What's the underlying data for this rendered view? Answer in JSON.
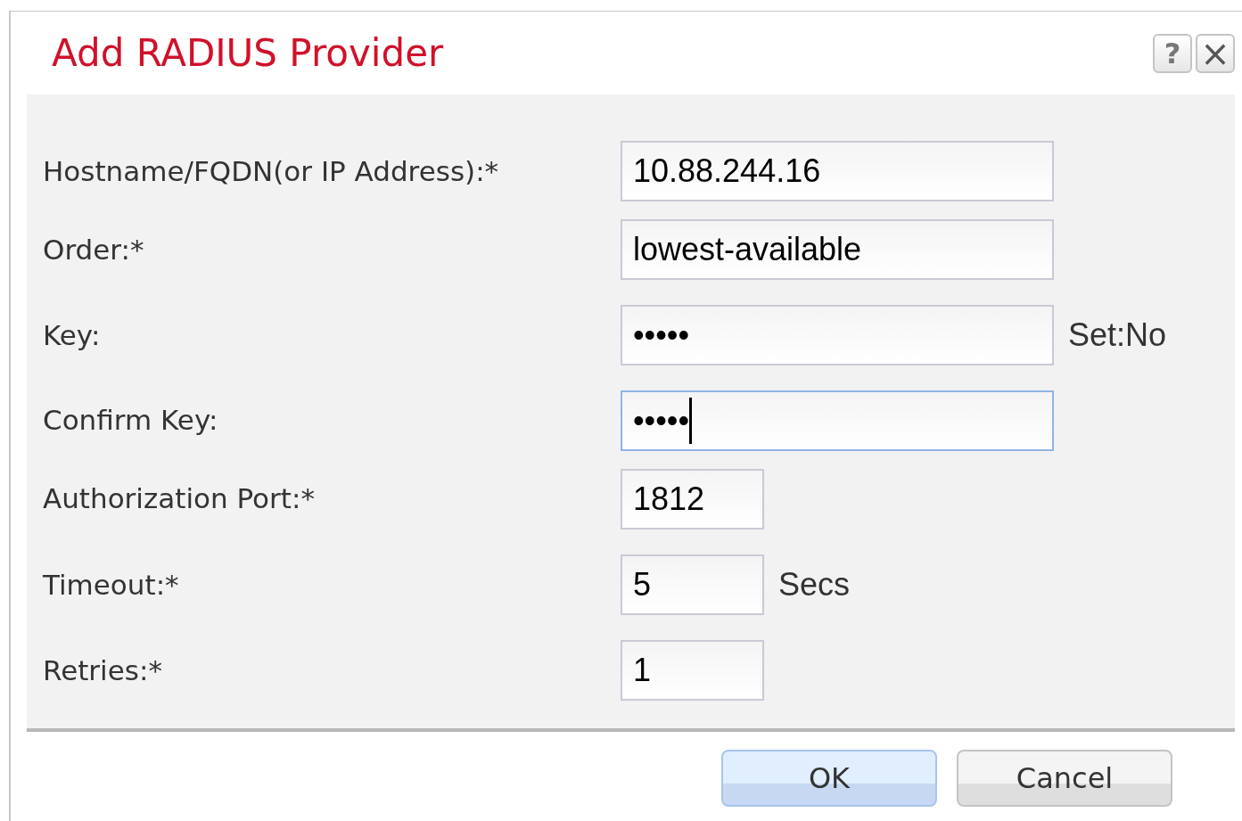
{
  "dialog": {
    "title": "Add RADIUS Provider",
    "help_button": "?",
    "close_button": "×"
  },
  "fields": [
    {
      "label": "Hostname/FQDN(or IP Address):*",
      "value": "10.88.244.16",
      "kind": "wide",
      "focused": false
    },
    {
      "label": "Order:*",
      "value": "lowest-available",
      "kind": "wide",
      "focused": false
    },
    {
      "label": "Key:",
      "value": "•••••",
      "kind": "wide",
      "focused": false,
      "suffix": "Set:No"
    },
    {
      "label": "Confirm Key:",
      "value": "•••••",
      "kind": "wide",
      "focused": true
    },
    {
      "label": "Authorization Port:*",
      "value": "1812",
      "kind": "narrow",
      "focused": false
    },
    {
      "label": "Timeout:*",
      "value": "5",
      "kind": "narrow",
      "focused": false,
      "suffix": "Secs"
    },
    {
      "label": "Retries:*",
      "value": "1",
      "kind": "narrow",
      "focused": false
    }
  ],
  "buttons": [
    {
      "label": "OK",
      "primary": true
    },
    {
      "label": "Cancel",
      "primary": false
    }
  ]
}
